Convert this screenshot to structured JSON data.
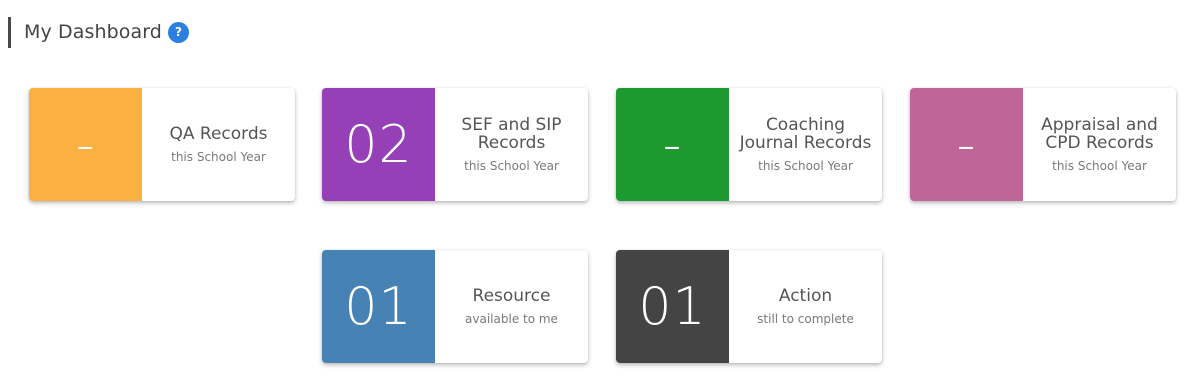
{
  "header": {
    "title": "My Dashboard",
    "help_glyph": "?",
    "help_color": "#2a7fe0"
  },
  "cards": [
    {
      "value": "-",
      "title": "QA Records",
      "subtitle": "this School Year",
      "color": "#fbb040"
    },
    {
      "value": "02",
      "title": "SEF and SIP Records",
      "subtitle": "this School Year",
      "color": "#9640b8"
    },
    {
      "value": "-",
      "title": "Coaching Journal Records",
      "subtitle": "this School Year",
      "color": "#1e9930"
    },
    {
      "value": "-",
      "title": "Appraisal and CPD Records",
      "subtitle": "this School Year",
      "color": "#bf6598"
    },
    {
      "value": "01",
      "title": "Resource",
      "subtitle": "available to me",
      "color": "#4682b4"
    },
    {
      "value": "01",
      "title": "Action",
      "subtitle": "still to complete",
      "color": "#444444"
    }
  ]
}
